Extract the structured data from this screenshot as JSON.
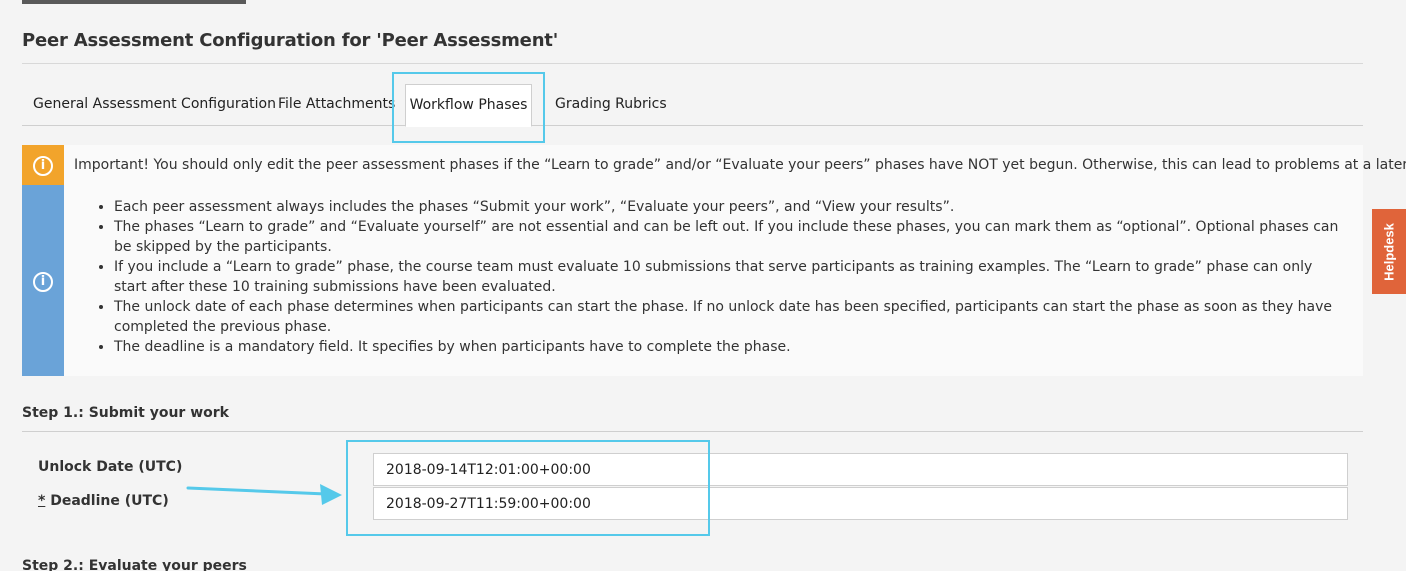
{
  "page": {
    "title": "Peer Assessment Configuration for 'Peer Assessment'"
  },
  "tabs": [
    {
      "label": "General Assessment Configuration"
    },
    {
      "label": "File Attachments"
    },
    {
      "label": "Workflow Phases"
    },
    {
      "label": "Grading Rubrics"
    }
  ],
  "alert": {
    "important": "Important! You should only edit the peer assessment phases if the “Learn to grade” and/or “Evaluate your peers” phases have NOT yet begun. Otherwise, this can lead to problems at a later stage!",
    "items": [
      "Each peer assessment always includes the phases “Submit your work”, “Evaluate your peers”, and “View your results”.",
      "The phases “Learn to grade” and “Evaluate yourself” are not essential and can be left out. If you include these phases, you can mark them as “optional”. Optional phases can be skipped by the participants.",
      "If you include a “Learn to grade” phase, the course team must evaluate 10 submissions that serve participants as training examples. The “Learn to grade” phase can only start after these 10 training submissions have been evaluated.",
      "The unlock date of each phase determines when participants can start the phase. If no unlock date has been specified, participants can start the phase as soon as they have completed the previous phase.",
      "The deadline is a mandatory field. It specifies by when participants have to complete the phase."
    ],
    "icon": "info-icon",
    "colors": {
      "warning": "#f2a42b",
      "info": "#6aa3d8"
    }
  },
  "step1": {
    "title": "Step 1.: Submit your work",
    "unlock_label": "Unlock Date (UTC)",
    "deadline_required": "*",
    "deadline_label": "Deadline (UTC)",
    "unlock_value": "2018-09-14T12:01:00+00:00",
    "deadline_value": "2018-09-27T11:59:00+00:00"
  },
  "step2": {
    "title": "Step 2.: Evaluate your peers"
  },
  "helpdesk": {
    "label": "Helpdesk",
    "color": "#e0643a"
  },
  "highlight_color": "#55c9ea"
}
